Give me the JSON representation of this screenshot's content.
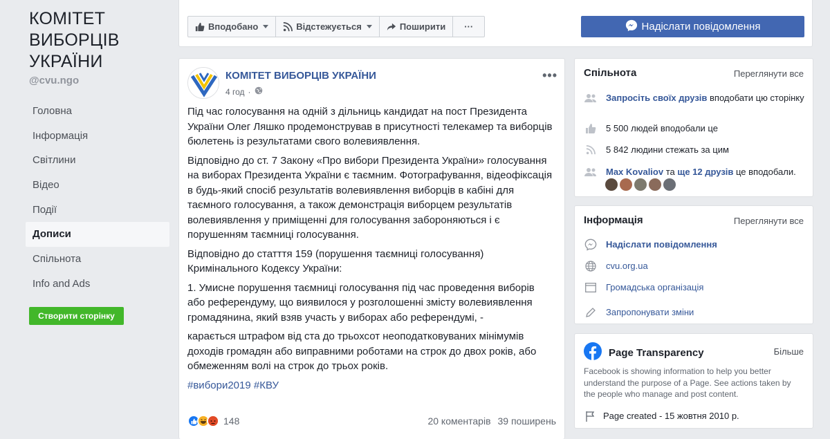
{
  "page": {
    "name": "КОМІТЕТ ВИБОРЦІВ УКРАЇНИ",
    "handle": "@cvu.ngo"
  },
  "nav": {
    "items": [
      {
        "label": "Головна"
      },
      {
        "label": "Інформація"
      },
      {
        "label": "Світлини"
      },
      {
        "label": "Відео"
      },
      {
        "label": "Події"
      },
      {
        "label": "Дописи"
      },
      {
        "label": "Спільнота"
      },
      {
        "label": "Info and Ads"
      }
    ],
    "active": "Дописи",
    "create_page_label": "Створити сторінку"
  },
  "actions": {
    "like_label": "Вподобано",
    "follow_label": "Відстежується",
    "share_label": "Поширити",
    "more_label": "···",
    "message_label": "Надіслати повідомлення"
  },
  "post": {
    "author": "КОМІТЕТ ВИБОРЦІВ УКРАЇНИ",
    "time": "4 год",
    "paragraphs": [
      "Під час голосування на одній з дільниць кандидат на пост Президента України Олег Ляшко продемонстрував в присутності телекамер та виборців бюлетень із результатами свого волевиявлення.",
      "Відповідно до ст. 7 Закону «Про вибори Президента України» голосування на виборах Президента України є таємним. Фотографування, відеофіксація в будь-який спосіб результатів волевиявлення виборців в кабіні для таємного голосування, а також демонстрація виборцем результатів волевиявлення у приміщенні для голосування забороняються і є порушенням таємниці голосування.",
      "Відповідно до статття 159 (порушення таємниці голосування) Кримінального Кодексу України:",
      "1. Умисне порушення таємниці голосування під час проведення виборів або референдуму, що виявилося у розголошенні змісту волевиявлення громадянина, який взяв участь у виборах або референдумі, -",
      "карається штрафом від ста до трьохсот неоподатковуваних мінімумів доходів громадян або виправними роботами на строк до двох років, або обмеженням волі на строк до трьох років."
    ],
    "hashtags": "#вибори2019 #КВУ",
    "reactions_count": "148",
    "comments": "20 коментарів",
    "shares": "39 поширень"
  },
  "community": {
    "title": "Спільнота",
    "see_all": "Переглянути все",
    "invite_link": "Запросіть своїх друзів",
    "invite_rest": " вподобати цю сторінку",
    "likes": "5 500 людей вподобали це",
    "followers": "5 842 людини стежать за цим",
    "friend_name": "Max Kovaliov",
    "friend_mid": " та ",
    "friend_more": "ще 12 друзів",
    "friend_rest": " це вподобали."
  },
  "info": {
    "title": "Інформація",
    "see_all": "Переглянути все",
    "send_message": "Надіслати повідомлення",
    "website": "cvu.org.ua",
    "category": "Громадська організація",
    "suggest": "Запропонувати зміни"
  },
  "transparency": {
    "title": "Page Transparency",
    "more": "Більше",
    "description": "Facebook is showing information to help you better understand the purpose of a Page. See actions taken by the people who manage and post content.",
    "created": "Page created - 15 жовтня 2010 р."
  },
  "colors": {
    "brand_blue": "#4267b2",
    "link_blue": "#365899",
    "green": "#42b72a",
    "background": "#e9ebee"
  }
}
